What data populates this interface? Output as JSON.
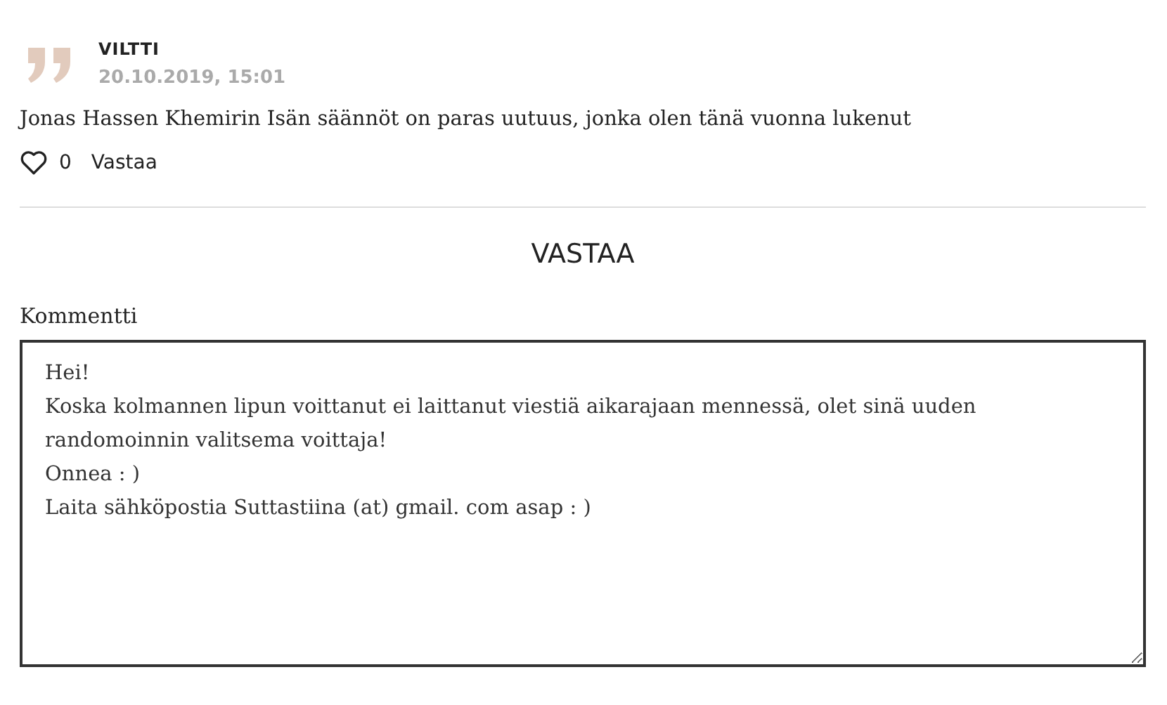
{
  "comment": {
    "author": "VILTTI",
    "date": "20.10.2019, 15:01",
    "body": "Jonas Hassen Khemirin Isän säännöt on paras uutuus, jonka olen tänä vuonna lukenut",
    "likes": "0",
    "liked": false,
    "reply_link": "Vastaa"
  },
  "reply_form": {
    "heading": "VASTAA",
    "field_label": "Kommentti",
    "value": "Hei!\nKoska kolmannen lipun voittanut ei laittanut viestiä aikarajaan mennessä, olet sinä uuden randomoinnin valitsema voittaja!\nOnnea : )\nLaita sähköpostia Suttastiina (at) gmail. com asap : )"
  }
}
